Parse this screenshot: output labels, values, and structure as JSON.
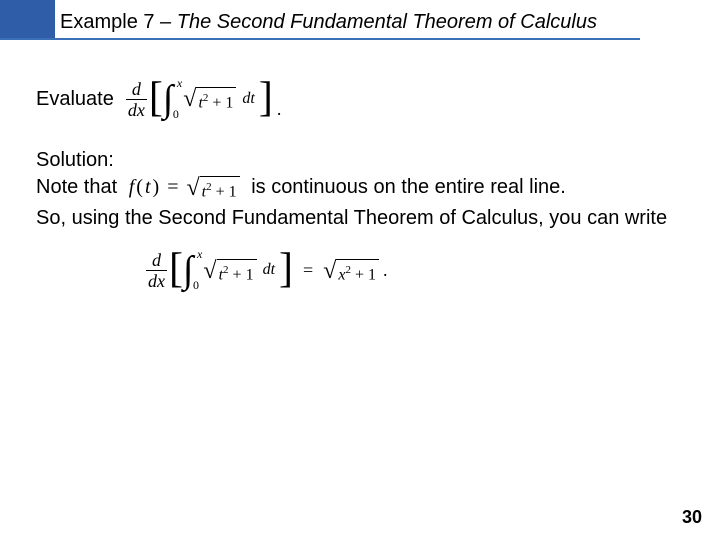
{
  "heading": {
    "prefix": "Example 7",
    "sep": " – ",
    "title": "The Second Fundamental Theorem of Calculus"
  },
  "body": {
    "evaluate_label": "Evaluate",
    "solution_label": "Solution:",
    "note_prefix": "Note that ",
    "note_suffix": " is continuous on the entire real line.",
    "so_line": "So, using the Second Fundamental Theorem of Calculus, you can write"
  },
  "math": {
    "d": "d",
    "dx": "dx",
    "int_lower": "0",
    "int_upper": "x",
    "var_t": "t",
    "var_x": "x",
    "sq": "2",
    "plus": " + ",
    "one": "1",
    "dt": "dt",
    "ft_label": "f",
    "ft_arg": "t",
    "period": "."
  },
  "page_number": "30"
}
